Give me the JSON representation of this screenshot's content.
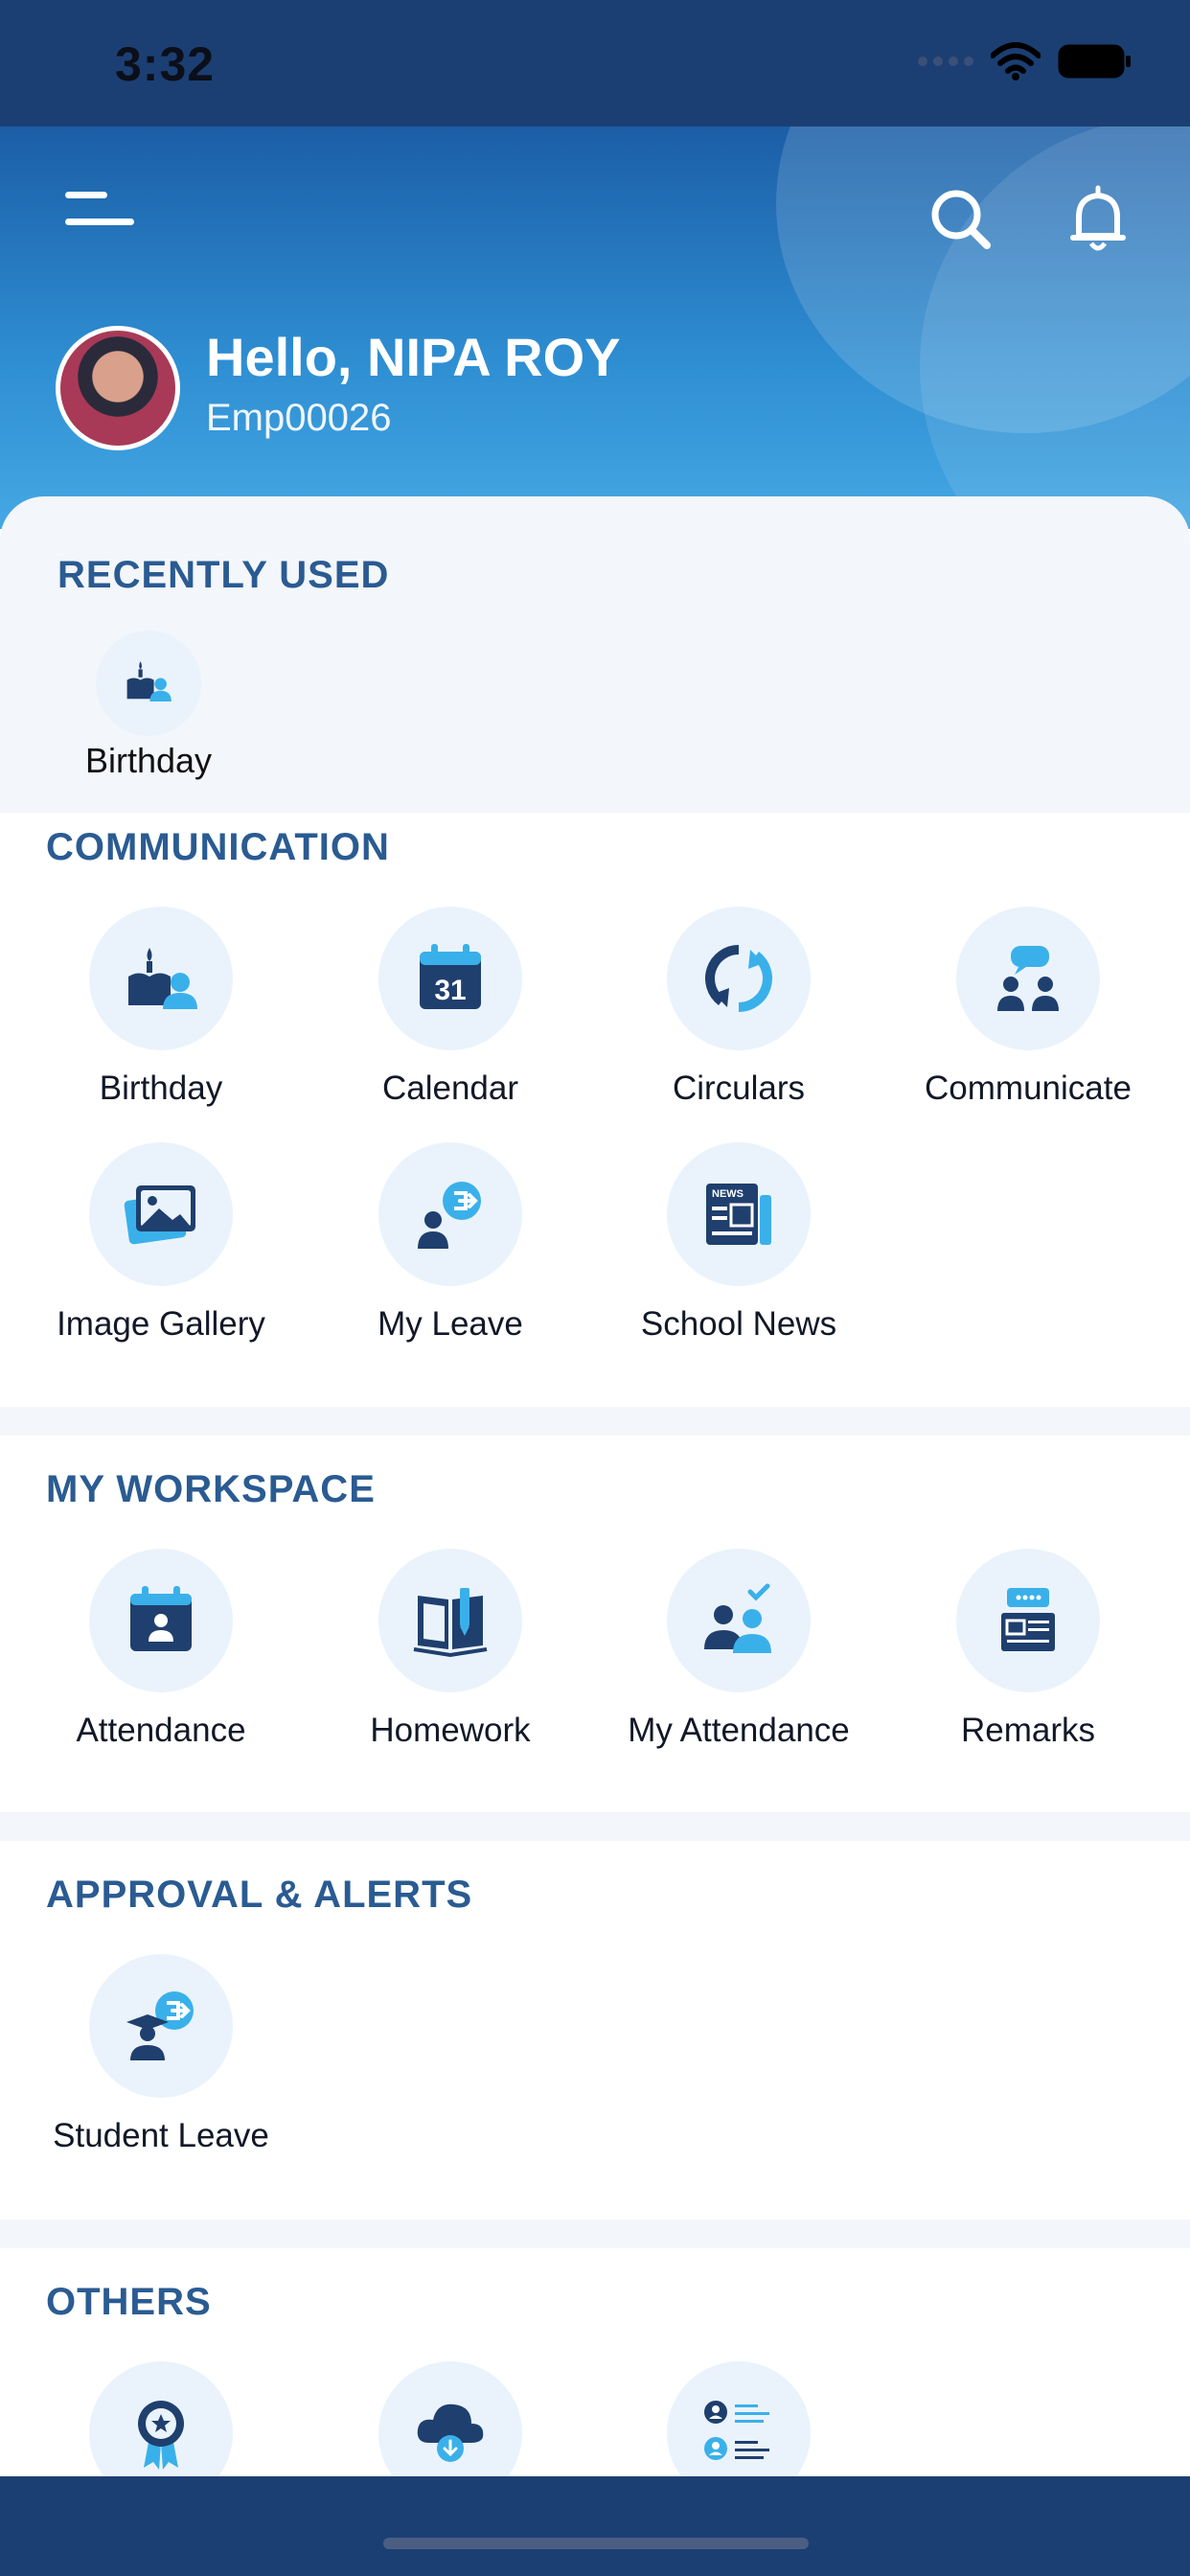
{
  "status_bar": {
    "time": "3:32"
  },
  "header": {
    "greeting": "Hello, NIPA ROY",
    "employee_id": "Emp00026"
  },
  "recently_used": {
    "title": "RECENTLY USED",
    "items": [
      {
        "label": "Birthday",
        "icon": "birthday-cake-icon"
      }
    ]
  },
  "sections": {
    "communication": {
      "title": "COMMUNICATION",
      "items": [
        {
          "label": "Birthday",
          "icon": "birthday-cake-icon"
        },
        {
          "label": "Calendar",
          "icon": "calendar-icon",
          "day": "31"
        },
        {
          "label": "Circulars",
          "icon": "refresh-arrows-icon"
        },
        {
          "label": "Communicate",
          "icon": "chat-people-icon"
        },
        {
          "label": "Image Gallery",
          "icon": "image-gallery-icon"
        },
        {
          "label": "My Leave",
          "icon": "leave-exit-icon"
        },
        {
          "label": "School News",
          "icon": "newspaper-icon",
          "badge": "NEWS"
        }
      ]
    },
    "workspace": {
      "title": "MY WORKSPACE",
      "items": [
        {
          "label": "Attendance",
          "icon": "attendance-calendar-icon"
        },
        {
          "label": "Homework",
          "icon": "homework-book-icon"
        },
        {
          "label": "My Attendance",
          "icon": "group-check-icon"
        },
        {
          "label": "Remarks",
          "icon": "remarks-board-icon"
        }
      ]
    },
    "approvals": {
      "title": "APPROVAL & ALERTS",
      "items": [
        {
          "label": "Student Leave",
          "icon": "student-leave-icon"
        }
      ]
    },
    "others": {
      "title": "OTHERS",
      "items": [
        {
          "icon": "award-badge-icon"
        },
        {
          "icon": "cloud-download-icon"
        },
        {
          "icon": "profile-list-icon"
        }
      ]
    }
  },
  "colors": {
    "navy": "#1b3f73",
    "accent_light": "#3ab0ea",
    "icon_dark": "#1f3f6e",
    "section_title": "#2a5b92",
    "tile_bg": "#eaf3fb"
  }
}
